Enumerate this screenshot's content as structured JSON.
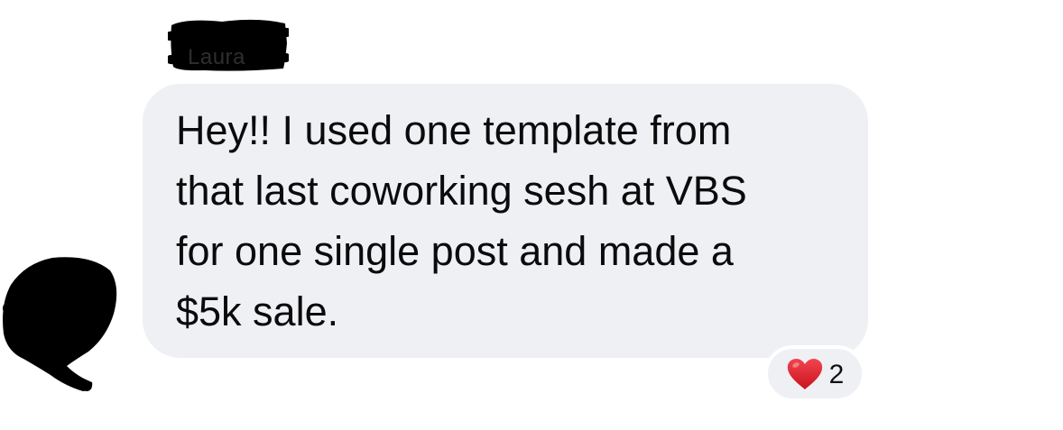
{
  "message": {
    "sender_name": "Laura",
    "text": "Hey!! I used one template from\nthat last coworking sesh at VBS\nfor one single post and made a\n$5k sale."
  },
  "reaction": {
    "icon": "red-heart-icon",
    "count": "2",
    "color": "#e0242f"
  },
  "colors": {
    "bubble_background": "#eff0f4",
    "text": "#0b0b0c",
    "redaction": "#000000"
  }
}
